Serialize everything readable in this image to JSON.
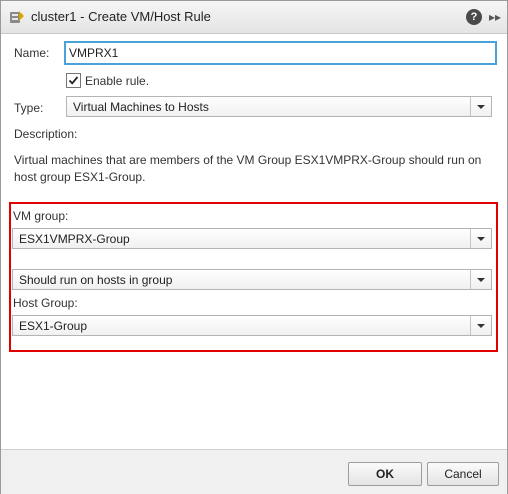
{
  "window": {
    "title": "cluster1 - Create VM/Host Rule"
  },
  "title_buttons": {
    "help": "?",
    "expand": "▸▸"
  },
  "form": {
    "name_label": "Name:",
    "name_value": "VMPRX1",
    "enable_rule_label": "Enable rule.",
    "enable_rule_checked": true,
    "type_label": "Type:",
    "type_value": "Virtual Machines to Hosts",
    "description_label": "Description:",
    "description_text": "Virtual machines that are members of the VM Group ESX1VMPRX-Group should run on host group ESX1-Group.",
    "vm_group_label": "VM group:",
    "vm_group_value": "ESX1VMPRX-Group",
    "relation_value": "Should run on hosts in group",
    "host_group_label": "Host Group:",
    "host_group_value": "ESX1-Group"
  },
  "footer": {
    "ok_label": "OK",
    "cancel_label": "Cancel"
  },
  "colors": {
    "highlight_border": "#e00000",
    "focus_border": "#4aa3d8"
  },
  "icons": {
    "title": "cluster-rule-icon",
    "help": "help-icon",
    "expand": "double-chevron-right-icon",
    "check": "checkmark-icon",
    "dropdown": "dropdown-arrow-icon"
  }
}
